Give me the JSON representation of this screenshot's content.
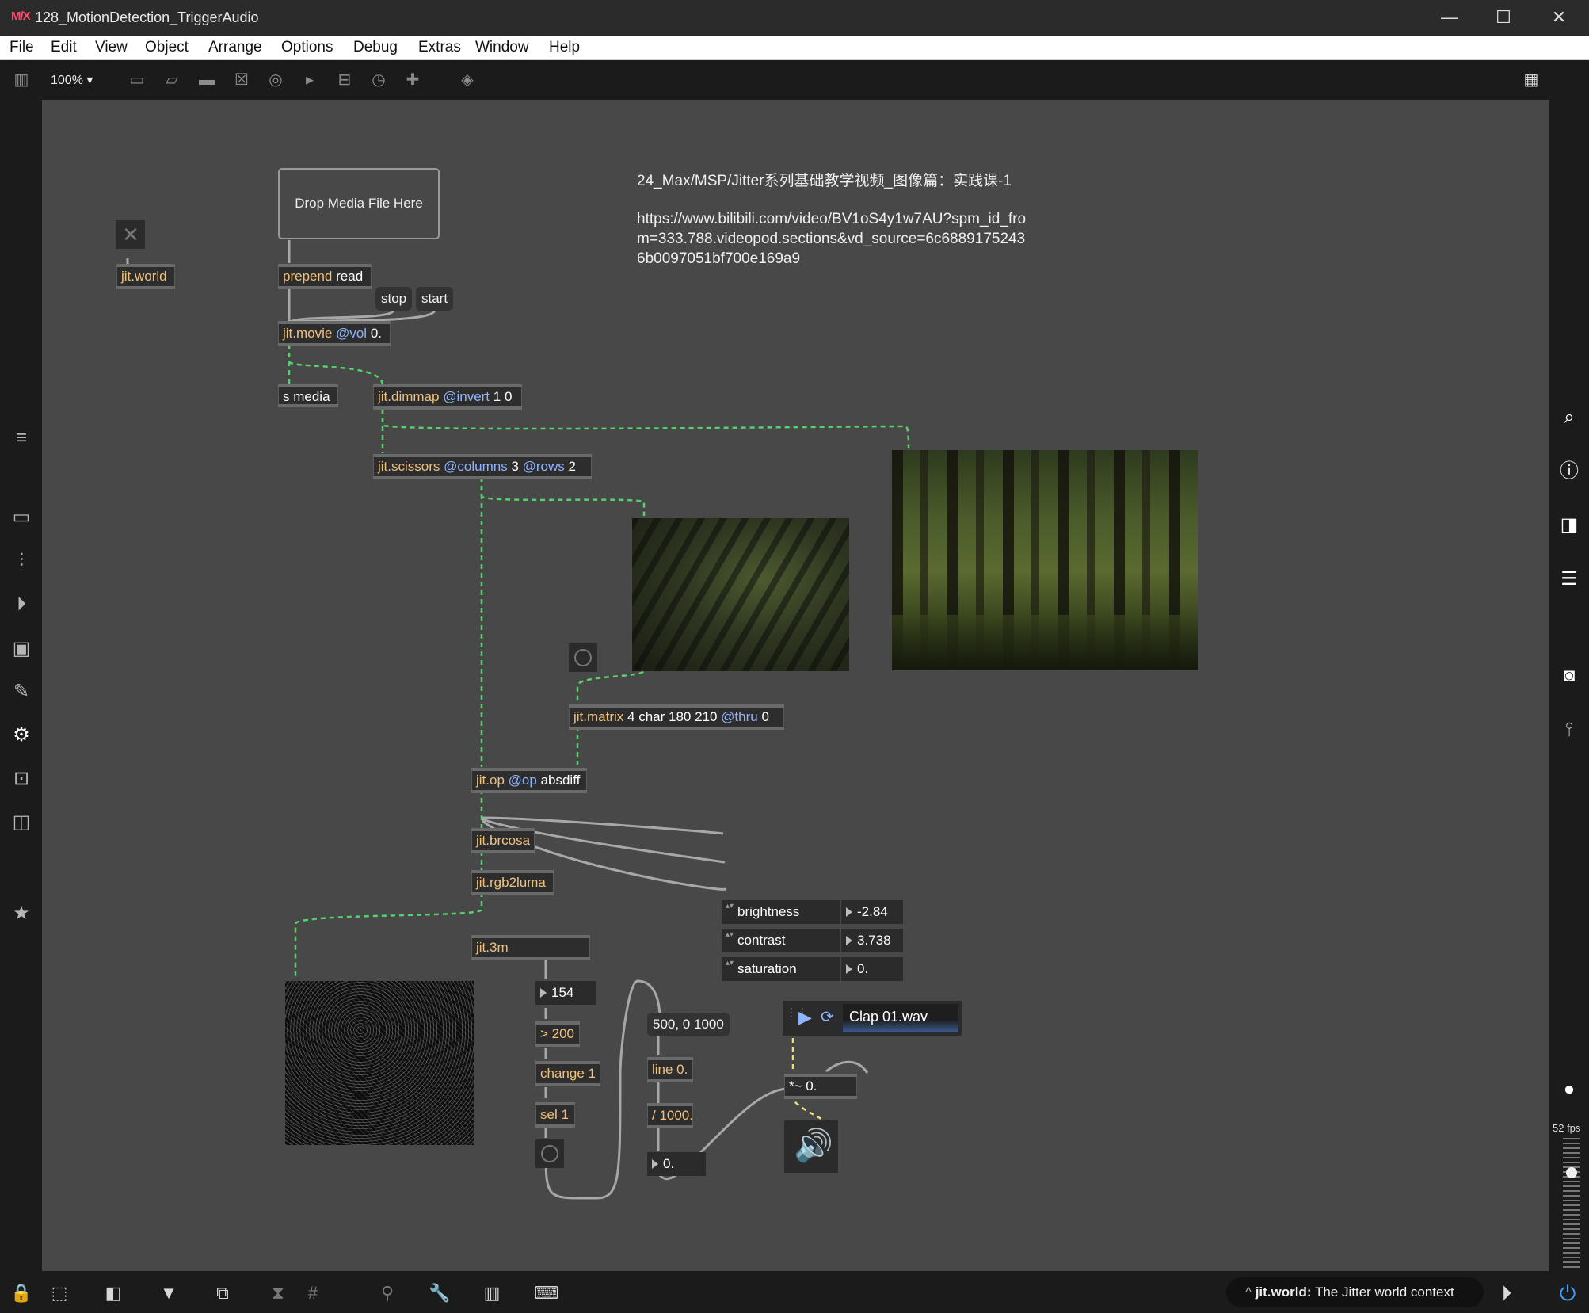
{
  "window": {
    "logo": "M/X",
    "title": "128_MotionDetection_TriggerAudio",
    "minimize": "—",
    "maximize": "☐",
    "close": "✕"
  },
  "menu": [
    "File",
    "Edit",
    "View",
    "Object",
    "Arrange",
    "Options",
    "Debug",
    "Extras",
    "Window",
    "Help"
  ],
  "toolbar": {
    "zoom": "100% ▾"
  },
  "patch": {
    "dropfile_label": "Drop Media File Here",
    "comment_title": "24_Max/MSP/Jitter系列基础教学视频_图像篇：实践课-1",
    "comment_url": "https://www.bilibili.com/video/BV1oS4y1w7AU?spm_id_fro\nm=333.788.videopod.sections&vd_source=6c6889175243\n6b0097051bf700e169a9",
    "jitworld": "jit.world",
    "prepend": {
      "name": "prepend",
      "arg": "read"
    },
    "stop": "stop",
    "start": "start",
    "jitmovie": {
      "name": "jit.movie",
      "attr": "@vol",
      "arg": "0."
    },
    "smedia": "s media",
    "dimmap": {
      "name": "jit.dimmap",
      "attr": "@invert",
      "arg": "1 0"
    },
    "scissors": {
      "name": "jit.scissors",
      "attr1": "@columns",
      "arg1": "3",
      "attr2": "@rows",
      "arg2": "2"
    },
    "jitmatrix": {
      "name": "jit.matrix",
      "arg": "4 char 180 210",
      "attr": "@thru",
      "arg2": "0"
    },
    "jitop": {
      "name": "jit.op",
      "attr": "@op",
      "arg": "absdiff"
    },
    "brcosa": "jit.brcosa",
    "rgb2luma": "jit.rgb2luma",
    "jit3m": "jit.3m",
    "attrs": [
      {
        "label": "brightness",
        "value": "-2.84"
      },
      {
        "label": "contrast",
        "value": "3.738"
      },
      {
        "label": "saturation",
        "value": "0."
      }
    ],
    "num154": "154",
    "gt": "> 200",
    "change": "change 1",
    "sel": "sel 1",
    "linemsg": "500, 0 1000",
    "lineobj": "line 0.",
    "div": "/ 1000.",
    "num0": "0.",
    "sfplay_file": "Clap 01.wav",
    "mul": "*~ 0."
  },
  "right": {
    "fps": "52 fps"
  },
  "status": {
    "obj": "jit.world:",
    "text": "The Jitter world context"
  }
}
